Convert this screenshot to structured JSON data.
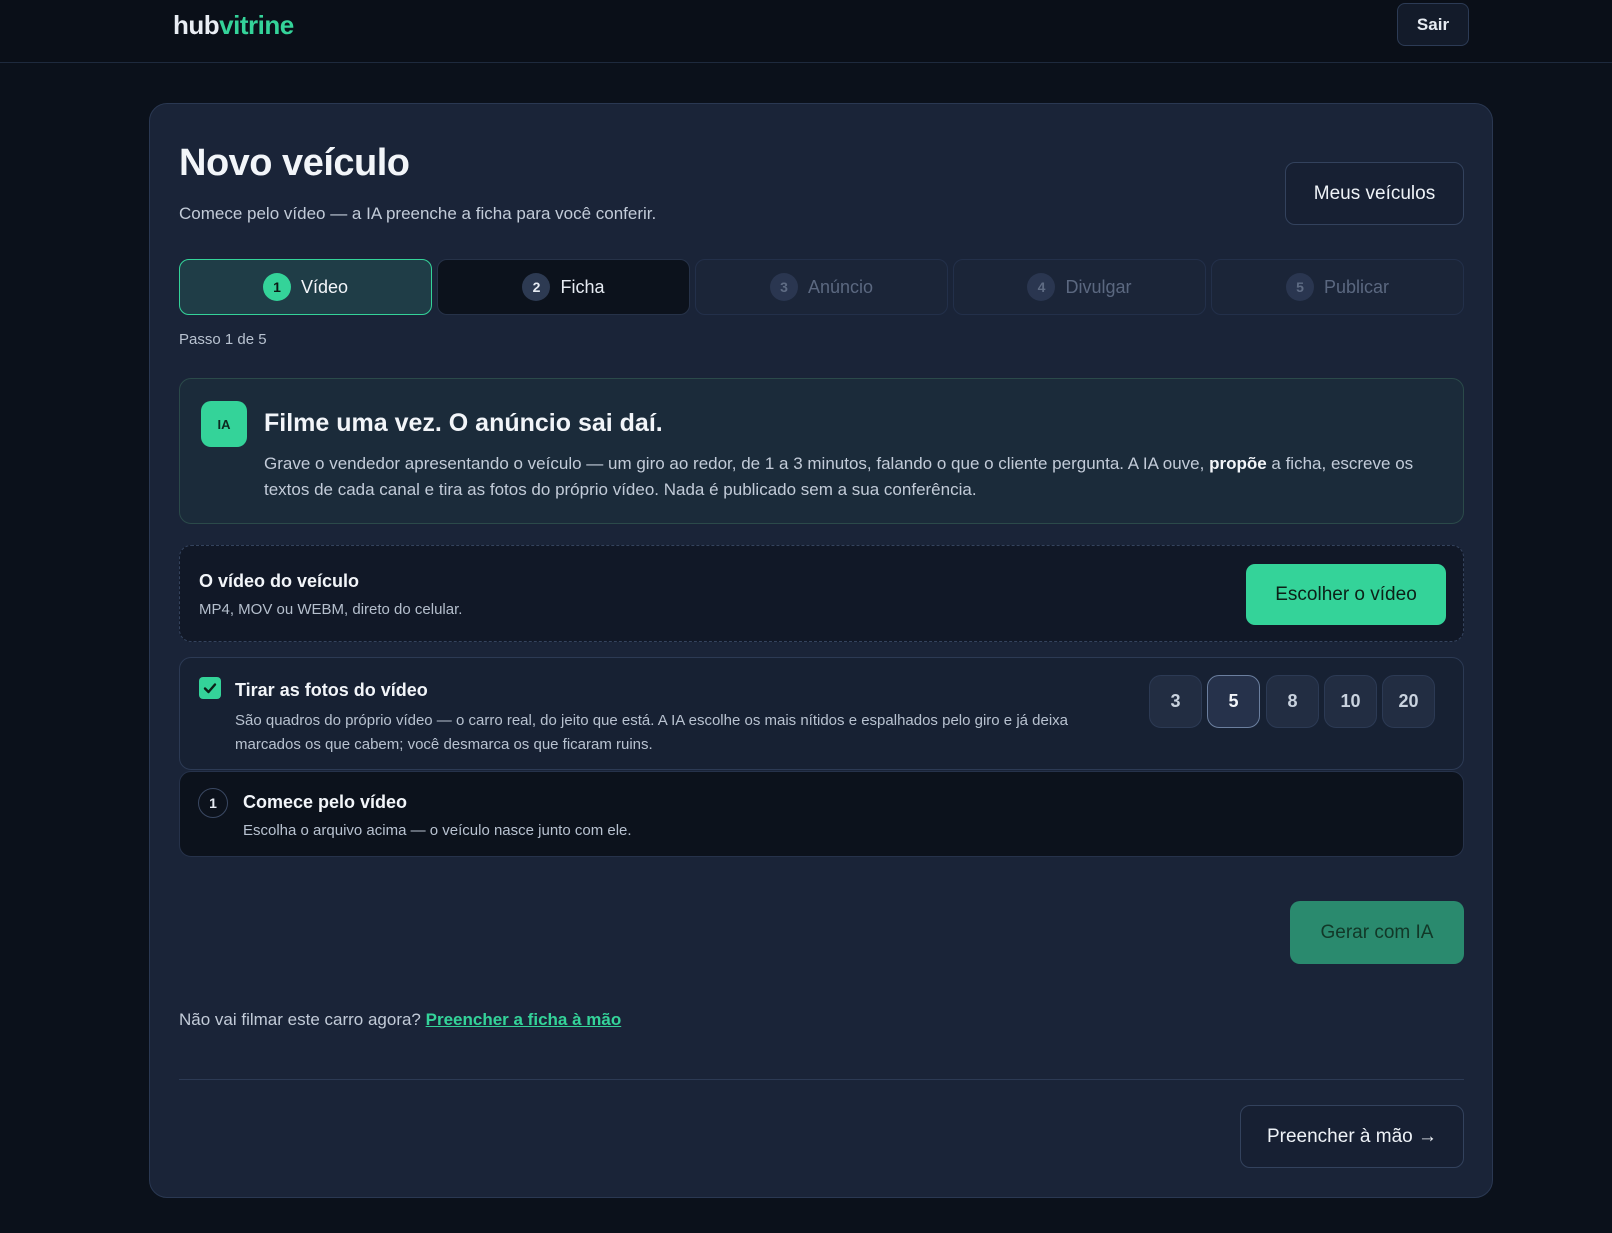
{
  "brand": {
    "part1": "hub",
    "part2": "vitrine"
  },
  "header": {
    "logout_label": "Sair"
  },
  "page": {
    "title": "Novo veículo",
    "subtitle": "Comece pelo vídeo — a IA preenche a ficha para você conferir.",
    "my_vehicles_label": "Meus veículos"
  },
  "steps": [
    {
      "num": "1",
      "label": "Vídeo",
      "state": "active"
    },
    {
      "num": "2",
      "label": "Ficha",
      "state": "next"
    },
    {
      "num": "3",
      "label": "Anúncio",
      "state": "locked"
    },
    {
      "num": "4",
      "label": "Divulgar",
      "state": "locked"
    },
    {
      "num": "5",
      "label": "Publicar",
      "state": "locked"
    }
  ],
  "progress_text": "Passo 1 de 5",
  "ia_box": {
    "badge": "IA",
    "heading": "Filme uma vez. O anúncio sai daí.",
    "text_before": "Grave o vendedor apresentando o veículo — um giro ao redor, de 1 a 3 minutos, falando o que o cliente pergunta. A IA ouve, ",
    "text_bold": "propõe",
    "text_after": " a ficha, escreve os textos de cada canal e tira as fotos do próprio vídeo. Nada é publicado sem a sua conferência."
  },
  "video": {
    "title": "O vídeo do veículo",
    "hint": "MP4, MOV ou WEBM, direto do celular.",
    "button_label": "Escolher o vídeo"
  },
  "photos": {
    "checked": true,
    "title": "Tirar as fotos do vídeo",
    "description": "São quadros do próprio vídeo — o carro real, do jeito que está. A IA escolhe os mais nítidos e espalhados pelo giro e já deixa marcados os que cabem; você desmarca os que ficaram ruins.",
    "counts": [
      "3",
      "5",
      "8",
      "10",
      "20"
    ],
    "selected_count": "5"
  },
  "status": {
    "num": "1",
    "title": "Comece pelo vídeo",
    "text": "Escolha o arquivo acima — o veículo nasce junto com ele."
  },
  "generate_label": "Gerar com IA",
  "manual": {
    "question": "Não vai filmar este carro agora?",
    "link_label": "Preencher a ficha à mão",
    "button_label": "Preencher à mão →"
  },
  "colors": {
    "accent": "#34d399",
    "background": "#0b111b",
    "card": "#1a2438"
  }
}
